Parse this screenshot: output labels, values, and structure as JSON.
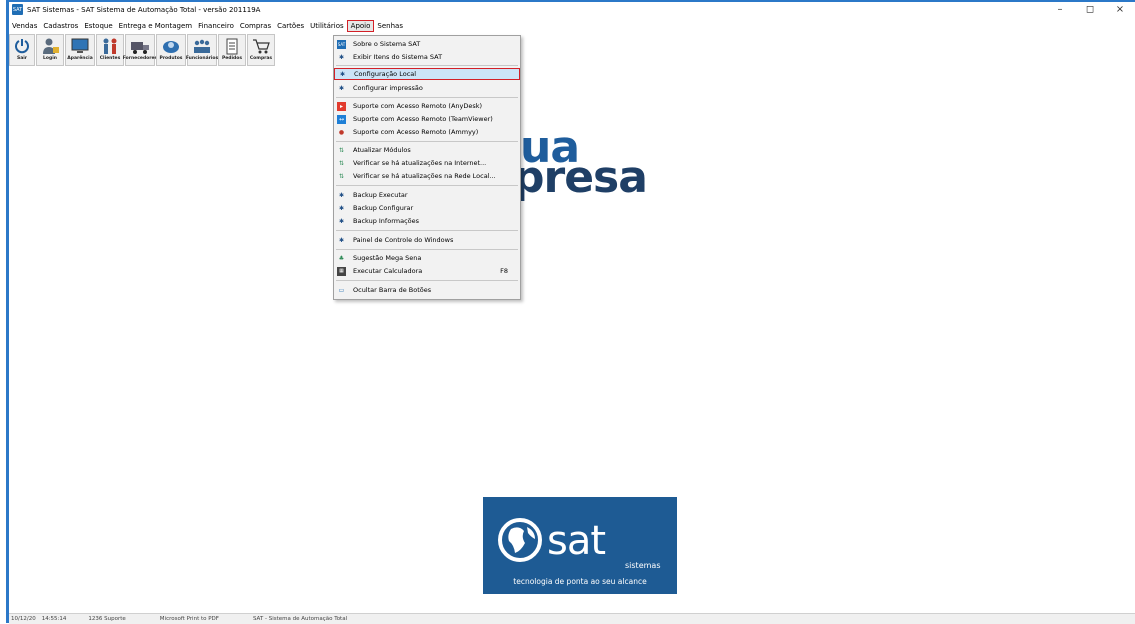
{
  "window": {
    "title": "SAT Sistemas - SAT Sistema de Automação Total - versão 201119A",
    "app_icon_text": "SAT",
    "minimize": "–",
    "maximize": "◻",
    "close": "×"
  },
  "menubar": {
    "items": [
      "Vendas",
      "Cadastros",
      "Estoque",
      "Entrega e Montagem",
      "Financeiro",
      "Compras",
      "Cartões",
      "Utilitários",
      "Apoio",
      "Senhas"
    ],
    "active": "Apoio"
  },
  "toolbar": {
    "buttons": [
      {
        "label": "Sair",
        "icon": "power-icon"
      },
      {
        "label": "Login",
        "icon": "user-lock-icon"
      },
      {
        "label": "Aparência",
        "icon": "monitor-icon"
      },
      {
        "label": "Clientes",
        "icon": "clients-icon"
      },
      {
        "label": "Fornecedores",
        "icon": "truck-icon"
      },
      {
        "label": "Produtos",
        "icon": "products-icon"
      },
      {
        "label": "Funcionários",
        "icon": "staff-icon"
      },
      {
        "label": "Pedidos",
        "icon": "clipboard-icon"
      },
      {
        "label": "Compras",
        "icon": "cart-icon"
      }
    ]
  },
  "apoio_menu": {
    "items": [
      {
        "label": "Sobre o Sistema SAT",
        "icon": "sat-icon"
      },
      {
        "label": "Exibir Itens do Sistema SAT",
        "icon": "gear-icon"
      },
      {
        "label": "Configuração Local",
        "icon": "gear-icon"
      },
      {
        "label": "Configurar impressão",
        "icon": "gear-icon"
      },
      {
        "label": "Suporte com Acesso Remoto (AnyDesk)",
        "icon": "anydesk-icon"
      },
      {
        "label": "Suporte com Acesso Remoto (TeamViewer)",
        "icon": "teamviewer-icon"
      },
      {
        "label": "Suporte com Acesso Remoto (Ammyy)",
        "icon": "ammyy-icon"
      },
      {
        "label": "Atualizar Módulos",
        "icon": "update-icon"
      },
      {
        "label": "Verificar se há atualizações na Internet...",
        "icon": "update-icon"
      },
      {
        "label": "Verificar se há atualizações na Rede Local...",
        "icon": "update-icon"
      },
      {
        "label": "Backup Executar",
        "icon": "gear-icon"
      },
      {
        "label": "Backup Configurar",
        "icon": "gear-icon"
      },
      {
        "label": "Backup Informações",
        "icon": "gear-icon"
      },
      {
        "label": "Painel de Controle do Windows",
        "icon": "gear-icon"
      },
      {
        "label": "Sugestão Mega Sena",
        "icon": "clover-icon"
      },
      {
        "label": "Executar Calculadora",
        "icon": "calculator-icon",
        "shortcut": "F8"
      },
      {
        "label": "Ocultar Barra de Botões",
        "icon": "screen-icon"
      }
    ],
    "highlighted": "Configuração Local"
  },
  "logo": {
    "line1": "ua",
    "line2": "presa"
  },
  "sat_logo": {
    "word": "sat",
    "sub": "sistemas",
    "tagline": "tecnologia de ponta ao seu alcance"
  },
  "status": {
    "date": "10/12/20",
    "time": "14:55:14",
    "user": "1236 Suporte",
    "printer": "Microsoft Print to PDF",
    "system": "SAT - Sistema de Automação Total"
  },
  "colors": {
    "frame_blue": "#2b78c8",
    "highlight_red": "#d32027",
    "menu_highlight": "#cce4f7",
    "sat_blue": "#1e5b94"
  }
}
